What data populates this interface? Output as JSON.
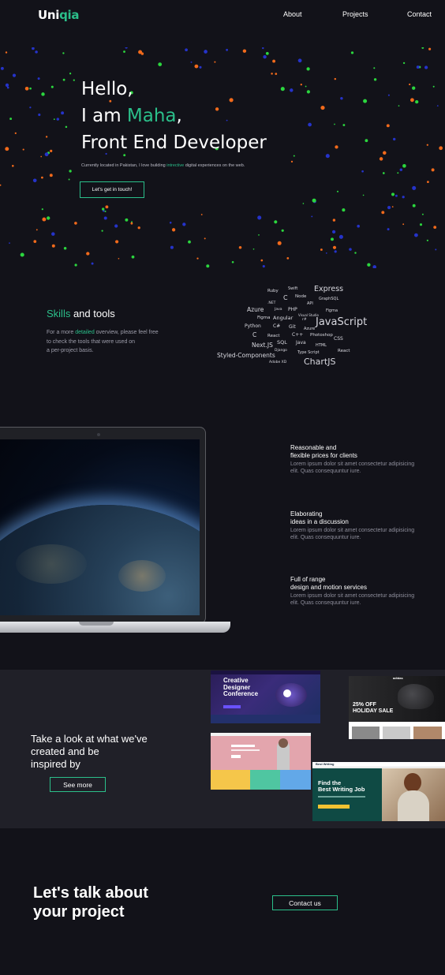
{
  "header": {
    "logo_main": "Uni",
    "logo_accent": "qia",
    "nav": [
      "About",
      "Projects",
      "Contact"
    ]
  },
  "hero": {
    "line1": "Hello,",
    "line2_prefix": "I am ",
    "line2_name": "Maha",
    "line2_suffix": ",",
    "line3": "Front End Developer",
    "sub_prefix": "Currently located in Pakistan, I love building ",
    "sub_accent": "intrective",
    "sub_suffix": " digital experiences on the web.",
    "button": "Let's get in touch!"
  },
  "dot_colors": [
    "#2bd63e",
    "#f26a1b",
    "#2533c9"
  ],
  "skills": {
    "title_accent": "Skills",
    "title_rest": " and tools",
    "text_l1_prefix": "For a more ",
    "text_l1_accent": "detailed",
    "text_l1_suffix": " overview, please feel free",
    "text_l2": "to check the tools that were used on",
    "text_l3": "a per-project basis.",
    "words": [
      "Ruby",
      "Swift",
      "Express",
      "C",
      "Node",
      "GraphSQL",
      ".NET",
      "API",
      "Azure",
      "Java",
      "PHP",
      "Figma",
      "Visual Studio",
      "Figma",
      "Angular",
      "r#",
      "JavaScript",
      "Python",
      "C#",
      "Git",
      "Azure",
      "C",
      "React",
      "C++",
      "Photoshop",
      "CSS",
      "Next.JS",
      "SQL",
      "Java",
      "HTML",
      "Django",
      "Type Script",
      "React",
      "Styled-Components",
      "Adobe XD",
      "ChartJS"
    ]
  },
  "features": [
    {
      "title_l1": "Reasonable and",
      "title_l2": "flexible prices for clients",
      "text_l1": "Lorem ipsum dolor sit amet consectetur adipisicing",
      "text_l2": "elit. Quas consequuntur iure."
    },
    {
      "title_l1": "Elaborating",
      "title_l2": "ideas in a discussion",
      "text_l1": "Lorem ipsum dolor sit amet consectetur adipisicing",
      "text_l2": "elit. Quas consequuntur iure."
    },
    {
      "title_l1": "Full of range",
      "title_l2": "design and motion services",
      "text_l1": "Lorem ipsum dolor sit amet consectetur adipisicing",
      "text_l2": "elit. Quas consequuntur iure."
    }
  ],
  "portfolio": {
    "title_l1": "Take a look at what we've",
    "title_l2": "created and be",
    "title_l3": "inspired by",
    "button": "See more",
    "shot1_title_l1": "Creative",
    "shot1_title_l2": "Designer",
    "shot1_title_l3": "Conference",
    "shot2_brand": "adidas",
    "shot2_sale_l1": "25% OFF",
    "shot2_sale_l2": "HOLIDAY SALE",
    "shot4_logo": "Best Writing",
    "shot4_title_l1": "Find the",
    "shot4_title_l2": "Best Writing Job"
  },
  "cta": {
    "title_l1": "Let's talk about",
    "title_l2": "your project",
    "button": "Contact us"
  }
}
